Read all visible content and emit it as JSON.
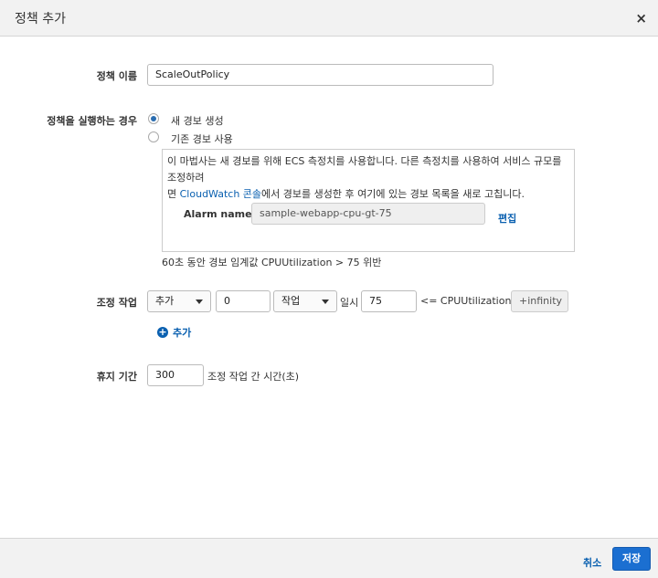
{
  "dialog": {
    "title": "정책 추가",
    "close_symbol": "×"
  },
  "policy_name": {
    "label": "정책 이름",
    "value": "ScaleOutPolicy"
  },
  "execute_when": {
    "label": "정책을 실행하는 경우",
    "options": [
      {
        "label": "새 경보 생성",
        "selected": true
      },
      {
        "label": "기존 경보 사용",
        "selected": false
      }
    ]
  },
  "alarm_box": {
    "text_line1": "이 마법사는 새 경보를 위해 ECS 측정치를 사용합니다. 다른 측정치를 사용하여 서비스 규모를 조정하려",
    "text_line2_prefix": "면 ",
    "text_link": "CloudWatch 콘솔",
    "text_line2_suffix": "에서 경보를 생성한 후 여기에 있는 경보 목록을 새로 고칩니다.",
    "alarm_name_label": "Alarm name",
    "alarm_name_value": "sample-webapp-cpu-gt-75",
    "edit_label": "편집"
  },
  "alarm_summary": "60초 동안 경보 임계값 CPUUtilization > 75 위반",
  "scaling_action": {
    "label": "조정 작업",
    "action_select": "추가",
    "amount": "0",
    "unit_select": "작업",
    "when_text": "일시",
    "lower_bound": "75",
    "condition_text": "<= CPUUtilization <",
    "upper_bound": "+infinity",
    "add_label": "추가"
  },
  "cooldown": {
    "label": "휴지 기간",
    "value": "300",
    "suffix": "조정 작업 간 시간(초)"
  },
  "footer": {
    "cancel_label": "취소",
    "save_label": "저장"
  },
  "colors": {
    "link": "#0a60b0",
    "primary_button": "#1b6fd1",
    "header_bg": "#f2f2f2"
  }
}
